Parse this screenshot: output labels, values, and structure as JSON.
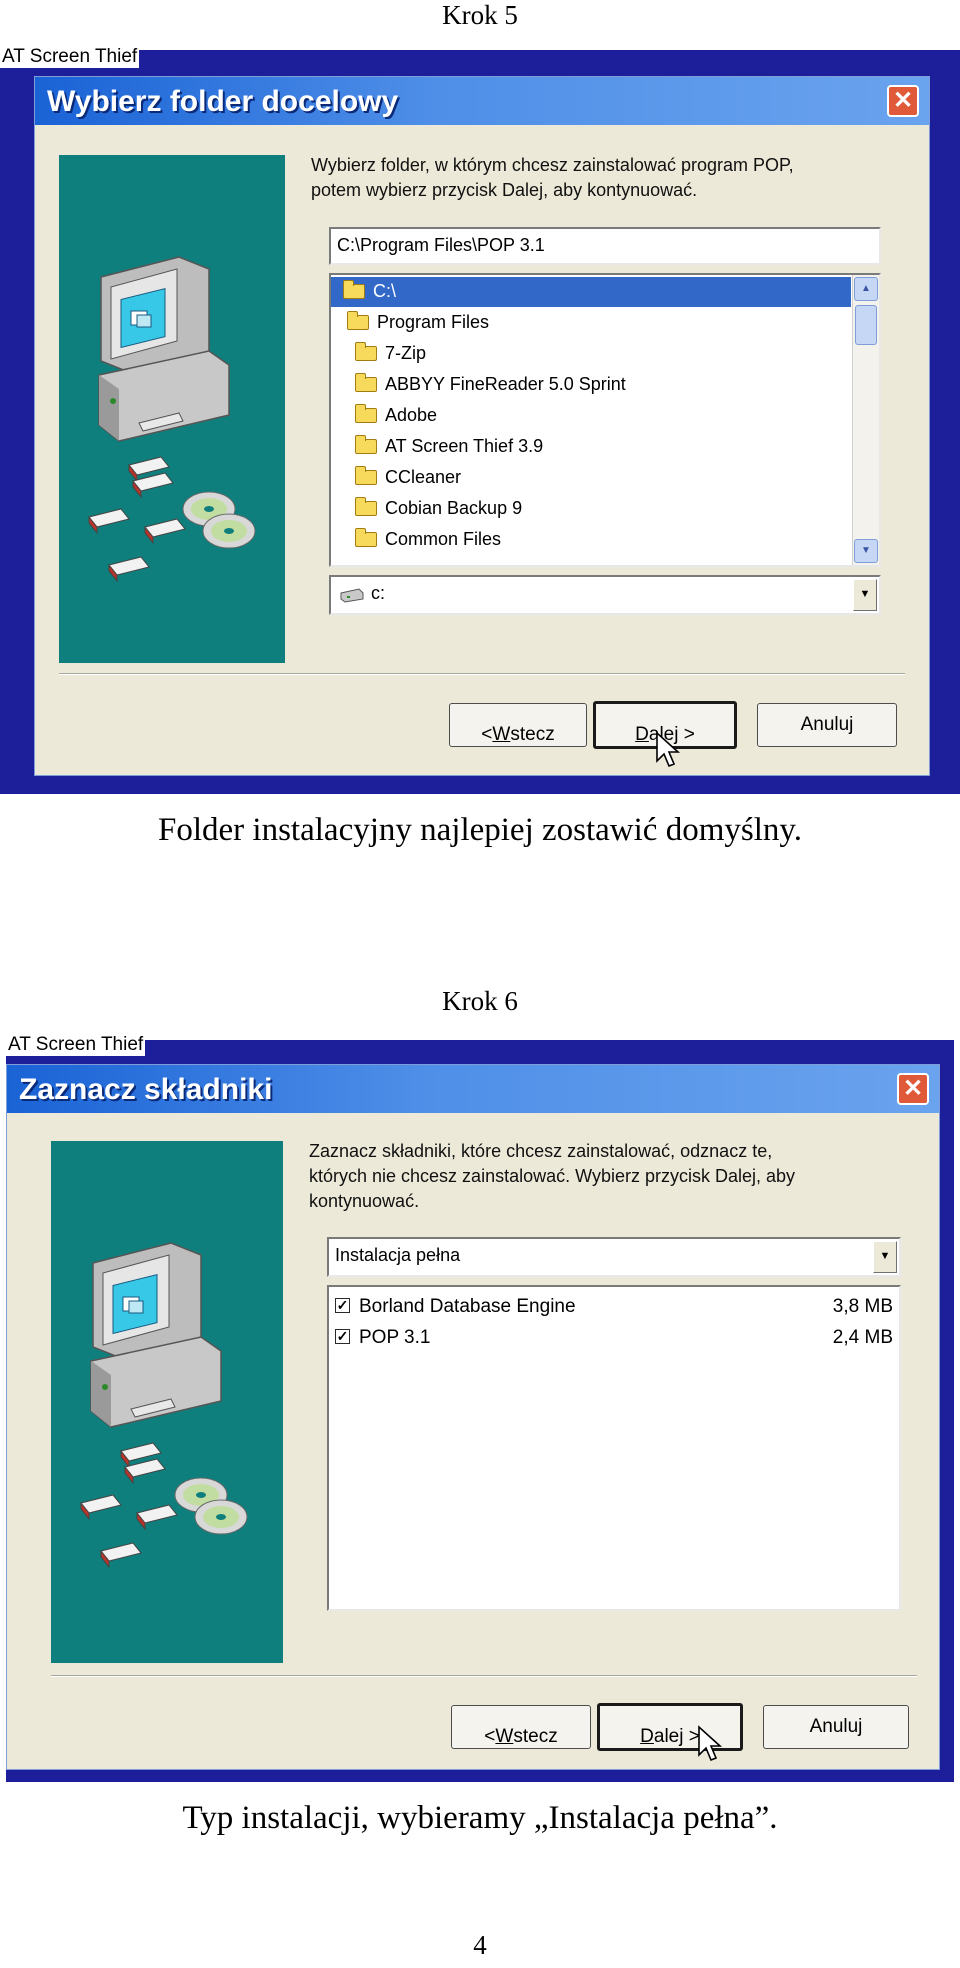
{
  "step5": {
    "heading": "Krok 5",
    "capture_label": "AT Screen Thief",
    "window_title": "Wybierz folder docelowy",
    "instructions": "Wybierz folder, w którym chcesz zainstalować program POP,\npotem wybierz przycisk Dalej, aby kontynuować.",
    "path_value": "C:\\Program Files\\POP 3.1",
    "tree_items": [
      {
        "label": "C:\\",
        "selected": true
      },
      {
        "label": "Program Files",
        "selected": false
      },
      {
        "label": "7-Zip",
        "selected": false
      },
      {
        "label": "ABBYY FineReader 5.0 Sprint",
        "selected": false
      },
      {
        "label": "Adobe",
        "selected": false
      },
      {
        "label": "AT Screen Thief 3.9",
        "selected": false
      },
      {
        "label": "CCleaner",
        "selected": false
      },
      {
        "label": "Cobian Backup 9",
        "selected": false
      },
      {
        "label": "Common Files",
        "selected": false
      }
    ],
    "drive_value": "c:",
    "buttons": {
      "back_prefix": "< ",
      "back_mnemonic": "W",
      "back_rest": "stecz",
      "next_mnemonic": "D",
      "next_rest": "alej >",
      "cancel": "Anuluj"
    },
    "caption": "Folder instalacyjny najlepiej zostawić domyślny."
  },
  "step6": {
    "heading": "Krok 6",
    "capture_label": "AT Screen Thief",
    "window_title": "Zaznacz składniki",
    "instructions": "Zaznacz składniki, które chcesz zainstalować, odznacz te,\nktórych nie chcesz zainstalować. Wybierz przycisk Dalej, aby\nkontynuować.",
    "install_type": "Instalacja pełna",
    "components": [
      {
        "label": "Borland Database Engine",
        "size": "3,8 MB",
        "checked": true
      },
      {
        "label": "POP 3.1",
        "size": "2,4 MB",
        "checked": true
      }
    ],
    "buttons": {
      "back_prefix": "< ",
      "back_mnemonic": "W",
      "back_rest": "stecz",
      "next_mnemonic": "D",
      "next_rest": "alej >",
      "cancel": "Anuluj"
    },
    "caption": "Typ instalacji, wybieramy „Instalacja pełna”."
  },
  "page_number": "4"
}
